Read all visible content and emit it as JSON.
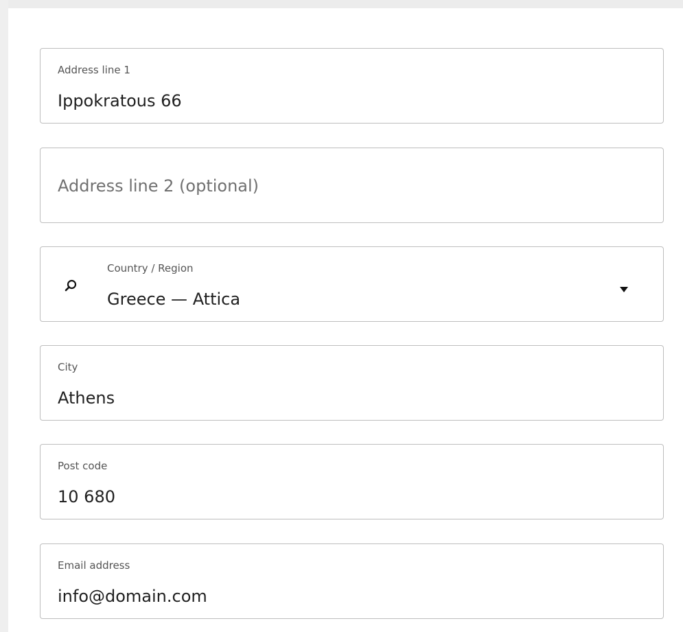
{
  "form": {
    "address_line_1": {
      "label": "Address line 1",
      "value": "Ippokratous 66"
    },
    "address_line_2": {
      "placeholder": "Address line 2 (optional)",
      "value": ""
    },
    "country_region": {
      "label": "Country / Region",
      "value": "Greece — Attica",
      "icon": "search-icon",
      "dropdown_icon": "caret-down-icon"
    },
    "city": {
      "label": "City",
      "value": "Athens"
    },
    "post_code": {
      "label": "Post code",
      "value": "10 680"
    },
    "email_address": {
      "label": "Email address",
      "value": "info@domain.com"
    }
  },
  "colors": {
    "border": "#bdbdbd",
    "label_text": "#545454",
    "value_text": "#1f1f1f",
    "placeholder_text": "#707070",
    "background": "#ffffff"
  }
}
